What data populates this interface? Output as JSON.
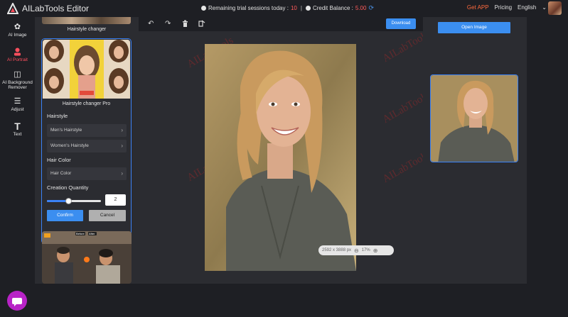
{
  "app": {
    "title": "AILabTools Editor"
  },
  "header": {
    "sessions_label": "Remaining trial sessions today :",
    "sessions_value": "10",
    "separator": "|",
    "credit_label": "Credit Balance :",
    "credit_value": "5.00",
    "get_app": "Get APP",
    "pricing": "Pricing",
    "language": "English"
  },
  "rail": {
    "items": [
      {
        "label": "AI Image",
        "icon": "ai-image-icon"
      },
      {
        "label": "AI Portrait",
        "icon": "portrait-icon"
      },
      {
        "label": "AI Background Remover",
        "icon": "background-remover-icon"
      },
      {
        "label": "Adjust",
        "icon": "adjust-icon"
      },
      {
        "label": "Text",
        "icon": "text-icon"
      }
    ]
  },
  "panel": {
    "top_card_label": "Hairstyle changer",
    "pro_label": "Hairstyle changer Pro",
    "hairstyle_title": "Hairstyle",
    "mens_hairstyle": "Men's Hairstyle",
    "womens_hairstyle": "Women's Hairstyle",
    "hair_color_title": "Hair Color",
    "hair_color_select": "Hair Color",
    "quantity_title": "Creation Quantity",
    "quantity_value": "2",
    "quantity_slider_fraction": 0.4,
    "confirm": "Confirm",
    "cancel": "Cancel",
    "before_after": [
      "Before",
      "After"
    ]
  },
  "toolbar": {
    "undo_icon": "undo-icon",
    "redo_icon": "redo-icon",
    "delete_icon": "trash-icon",
    "clear_icon": "clear-icon",
    "download": "Download"
  },
  "canvas": {
    "watermark": "AILabTools",
    "image_size": "2592 x 3888 px",
    "zoom": "17%"
  },
  "right": {
    "open_image": "Open Image"
  },
  "colors": {
    "accent_blue": "#3b8ef0",
    "active_red": "#ff4f5e",
    "get_app_orange": "#ff6a3d",
    "chat_purple": "#b823c7"
  }
}
